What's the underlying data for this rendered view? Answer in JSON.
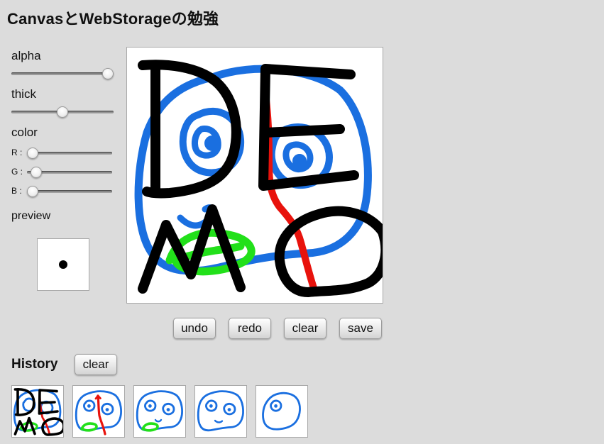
{
  "page": {
    "title": "CanvasとWebStorageの勉強"
  },
  "controls": {
    "alpha_label": "alpha",
    "alpha_value": 1.0,
    "thick_label": "thick",
    "thick_value": 0.5,
    "color_label": "color",
    "r_label": "R :",
    "g_label": "G :",
    "b_label": "B :",
    "r_value": 0,
    "g_value": 0.05,
    "b_value": 0,
    "preview_label": "preview",
    "preview_color": "#000000"
  },
  "toolbar": {
    "undo_label": "undo",
    "redo_label": "redo",
    "clear_label": "clear",
    "save_label": "save"
  },
  "history": {
    "title": "History",
    "clear_label": "clear"
  },
  "colors": {
    "background": "#dcdcdc",
    "stroke_black": "#000000",
    "stroke_blue": "#1a6fe0",
    "stroke_red": "#e8120c",
    "stroke_green": "#22e01a"
  },
  "icons": [
    "pen-preview-dot"
  ]
}
